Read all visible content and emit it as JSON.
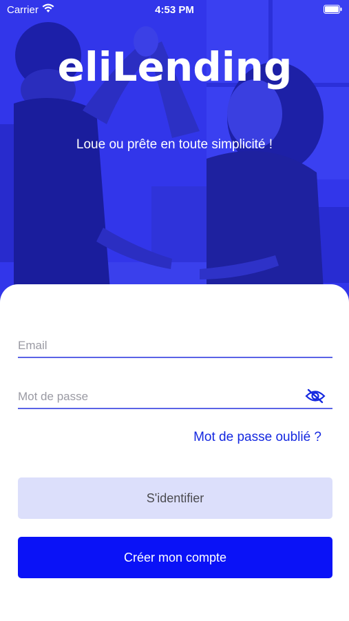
{
  "status_bar": {
    "carrier": "Carrier",
    "time": "4:53 PM"
  },
  "brand": {
    "logo_text": "eliLending",
    "tagline": "Loue ou prête en toute simplicité !"
  },
  "form": {
    "email_placeholder": "Email",
    "password_placeholder": "Mot de passe",
    "forgot_password": "Mot de passe oublié ?",
    "login_button": "S'identifier",
    "create_account_button": "Créer mon compte"
  },
  "colors": {
    "brand_blue": "#0a12f7",
    "hero_overlay": "#2a2ee8",
    "login_button_bg": "#dcdffb",
    "link": "#1428e0"
  },
  "icons": {
    "wifi": "wifi-icon",
    "battery": "battery-icon",
    "eye": "eye-slash-icon",
    "photo": "hero-photo"
  }
}
